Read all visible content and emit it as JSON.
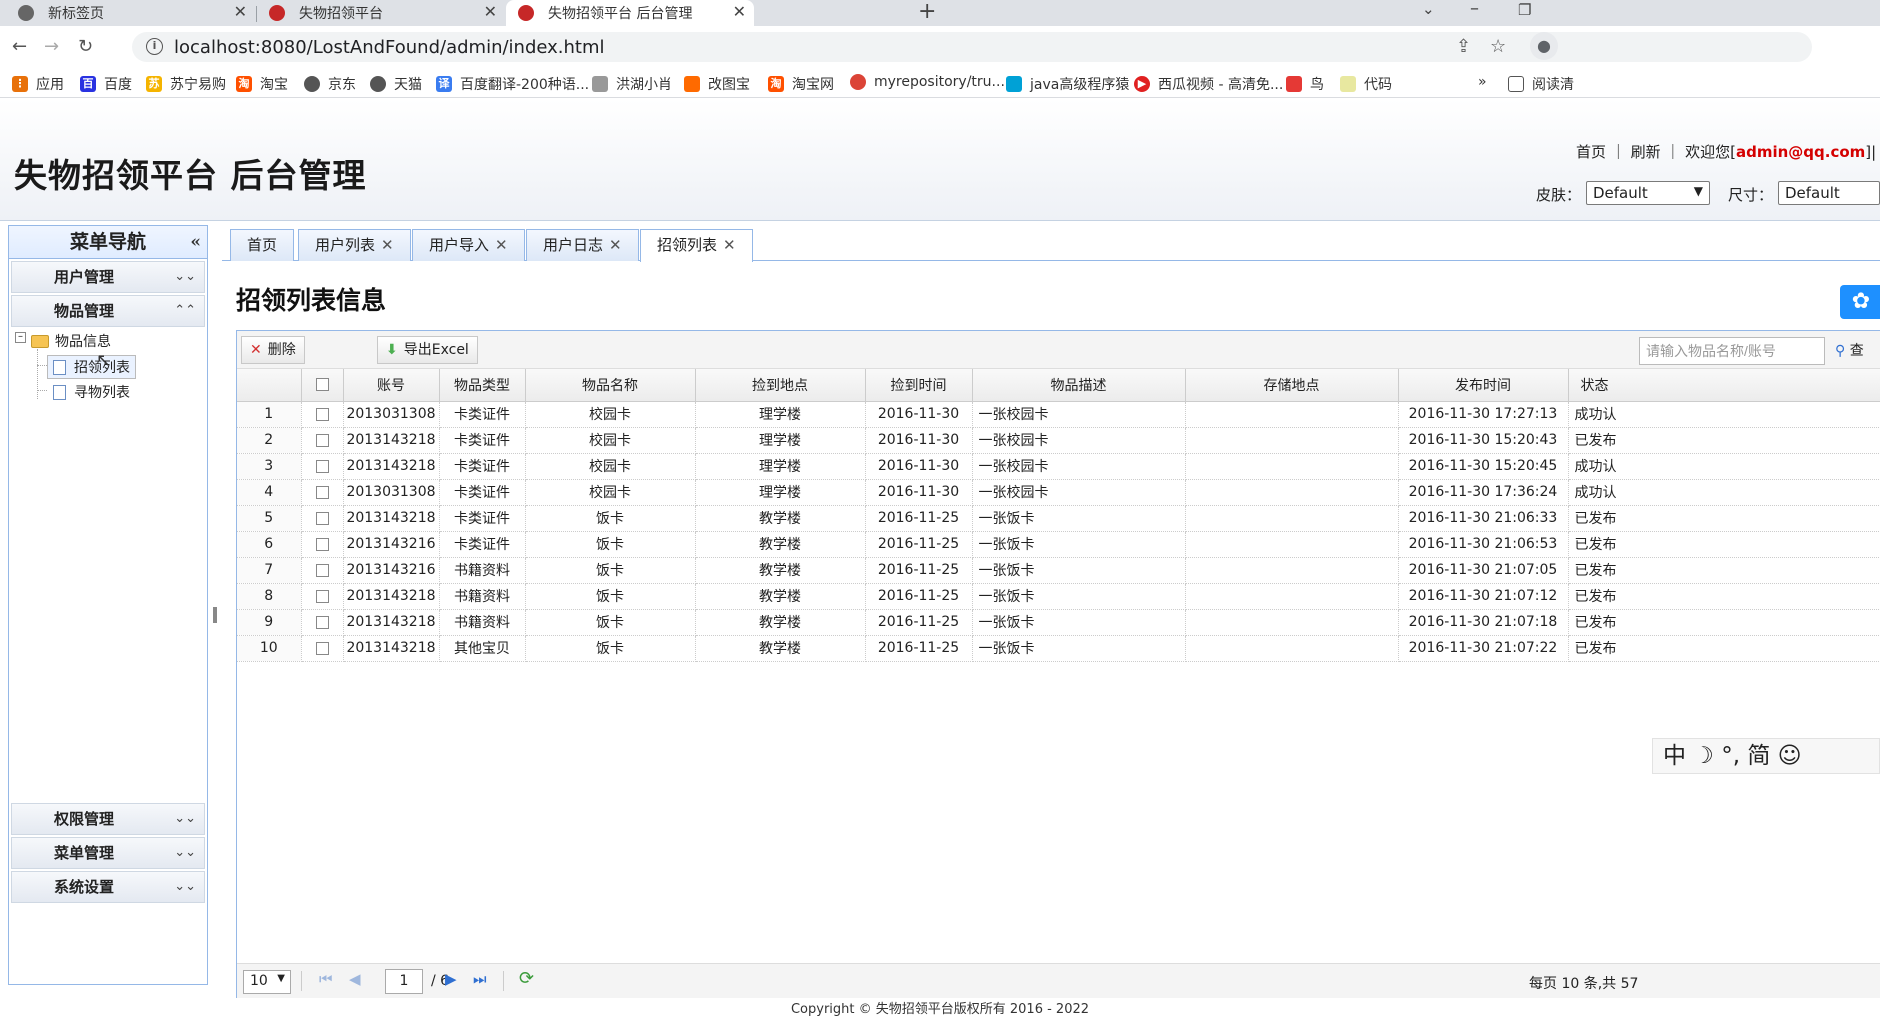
{
  "browser": {
    "tabs": [
      {
        "title": "新标签页"
      },
      {
        "title": "失物招领平台"
      },
      {
        "title": "失物招领平台 后台管理"
      }
    ],
    "url": "localhost:8080/LostAndFound/admin/index.html",
    "bookmarks": [
      "应用",
      "百度",
      "苏宁易购",
      "淘宝",
      "京东",
      "天猫",
      "百度翻译-200种语...",
      "洪湖小肖",
      "改图宝",
      "淘宝网",
      "myrepository/tru...",
      "java高级程序猿",
      "西瓜视频 - 高清免...",
      "鸟",
      "代码"
    ],
    "reading_list": "阅读清"
  },
  "header": {
    "title": "失物招领平台 后台管理",
    "links": {
      "home": "首页",
      "refresh": "刷新",
      "welcome": "欢迎您[",
      "user": "admin@qq.com",
      "close_bracket": "]|"
    },
    "skin_label": "皮肤：",
    "skin_value": "Default",
    "size_label": "尺寸：",
    "size_value": "Default"
  },
  "sidebar": {
    "title": "菜单导航",
    "collapse_icon": "«",
    "groups": [
      "用户管理",
      "物品管理",
      "权限管理",
      "菜单管理",
      "系统设置"
    ],
    "tree": {
      "folder": "物品信息",
      "items": [
        "招领列表",
        "寻物列表"
      ]
    }
  },
  "tabs": [
    {
      "label": "首页"
    },
    {
      "label": "用户列表"
    },
    {
      "label": "用户导入"
    },
    {
      "label": "用户日志"
    },
    {
      "label": "招领列表"
    }
  ],
  "main": {
    "title": "招领列表信息",
    "toolbar": {
      "delete_label": "删除",
      "export_label": "导出Excel"
    },
    "search": {
      "placeholder": "请输入物品名称/账号",
      "button_label": "查"
    },
    "columns": [
      "账号",
      "物品类型",
      "物品名称",
      "捡到地点",
      "捡到时间",
      "物品描述",
      "存储地点",
      "发布时间",
      "状态"
    ],
    "rows": [
      {
        "n": "1",
        "account": "2013031308",
        "type": "卡类证件",
        "name": "校园卡",
        "place": "理学楼",
        "date": "2016-11-30",
        "desc": "一张校园卡",
        "storage": "",
        "published": "2016-11-30 17:27:13",
        "status": "成功认"
      },
      {
        "n": "2",
        "account": "2013143218",
        "type": "卡类证件",
        "name": "校园卡",
        "place": "理学楼",
        "date": "2016-11-30",
        "desc": "一张校园卡",
        "storage": "",
        "published": "2016-11-30 15:20:43",
        "status": "已发布"
      },
      {
        "n": "3",
        "account": "2013143218",
        "type": "卡类证件",
        "name": "校园卡",
        "place": "理学楼",
        "date": "2016-11-30",
        "desc": "一张校园卡",
        "storage": "",
        "published": "2016-11-30 15:20:45",
        "status": "成功认"
      },
      {
        "n": "4",
        "account": "2013031308",
        "type": "卡类证件",
        "name": "校园卡",
        "place": "理学楼",
        "date": "2016-11-30",
        "desc": "一张校园卡",
        "storage": "",
        "published": "2016-11-30 17:36:24",
        "status": "成功认"
      },
      {
        "n": "5",
        "account": "2013143218",
        "type": "卡类证件",
        "name": "饭卡",
        "place": "教学楼",
        "date": "2016-11-25",
        "desc": "一张饭卡",
        "storage": "",
        "published": "2016-11-30 21:06:33",
        "status": "已发布"
      },
      {
        "n": "6",
        "account": "2013143216",
        "type": "卡类证件",
        "name": "饭卡",
        "place": "教学楼",
        "date": "2016-11-25",
        "desc": "一张饭卡",
        "storage": "",
        "published": "2016-11-30 21:06:53",
        "status": "已发布"
      },
      {
        "n": "7",
        "account": "2013143216",
        "type": "书籍资料",
        "name": "饭卡",
        "place": "教学楼",
        "date": "2016-11-25",
        "desc": "一张饭卡",
        "storage": "",
        "published": "2016-11-30 21:07:05",
        "status": "已发布"
      },
      {
        "n": "8",
        "account": "2013143218",
        "type": "书籍资料",
        "name": "饭卡",
        "place": "教学楼",
        "date": "2016-11-25",
        "desc": "一张饭卡",
        "storage": "",
        "published": "2016-11-30 21:07:12",
        "status": "已发布"
      },
      {
        "n": "9",
        "account": "2013143218",
        "type": "书籍资料",
        "name": "饭卡",
        "place": "教学楼",
        "date": "2016-11-25",
        "desc": "一张饭卡",
        "storage": "",
        "published": "2016-11-30 21:07:18",
        "status": "已发布"
      },
      {
        "n": "10",
        "account": "2013143218",
        "type": "其他宝贝",
        "name": "饭卡",
        "place": "教学楼",
        "date": "2016-11-25",
        "desc": "一张饭卡",
        "storage": "",
        "published": "2016-11-30 21:07:22",
        "status": "已发布"
      }
    ]
  },
  "pager": {
    "page_size": "10",
    "current_page": "1",
    "total_pages": "/ 6",
    "info": "每页 10 条,共 57"
  },
  "footer": "Copyright © 失物招领平台版权所有 2016 - 2022",
  "ime": "中 ☽ °, 简 ☺"
}
